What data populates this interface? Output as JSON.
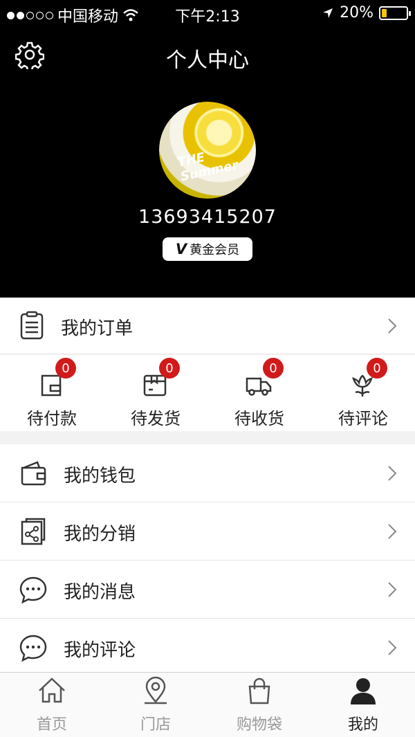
{
  "status_bar": {
    "carrier": "中国移动",
    "time": "下午2:13",
    "battery": "20%",
    "battery_level": 0.2
  },
  "header": {
    "title": "个人中心",
    "settings_icon": "gear-icon",
    "avatar_text": "THE Summer",
    "phone": "13693415207",
    "member_v": "V",
    "member_level": "黄金会员"
  },
  "orders": {
    "label": "我的订单",
    "icon": "clipboard-icon",
    "statuses": [
      {
        "label": "待付款",
        "count": "0",
        "icon": "wallet-icon"
      },
      {
        "label": "待发货",
        "count": "0",
        "icon": "package-icon"
      },
      {
        "label": "待收货",
        "count": "0",
        "icon": "truck-icon"
      },
      {
        "label": "待评论",
        "count": "0",
        "icon": "flower-icon"
      }
    ]
  },
  "menu": [
    {
      "label": "我的钱包",
      "icon": "wallet-icon"
    },
    {
      "label": "我的分销",
      "icon": "share-icon"
    },
    {
      "label": "我的消息",
      "icon": "chat-icon"
    },
    {
      "label": "我的评论",
      "icon": "chat-icon"
    }
  ],
  "tabbar": [
    {
      "label": "首页",
      "icon": "home-icon"
    },
    {
      "label": "门店",
      "icon": "location-icon"
    },
    {
      "label": "购物袋",
      "icon": "bag-icon"
    },
    {
      "label": "我的",
      "icon": "user-icon",
      "active": true
    }
  ],
  "colors": {
    "header_bg": "#000000",
    "badge_red": "#d11a1a",
    "battery_yellow": "#f6c700"
  }
}
